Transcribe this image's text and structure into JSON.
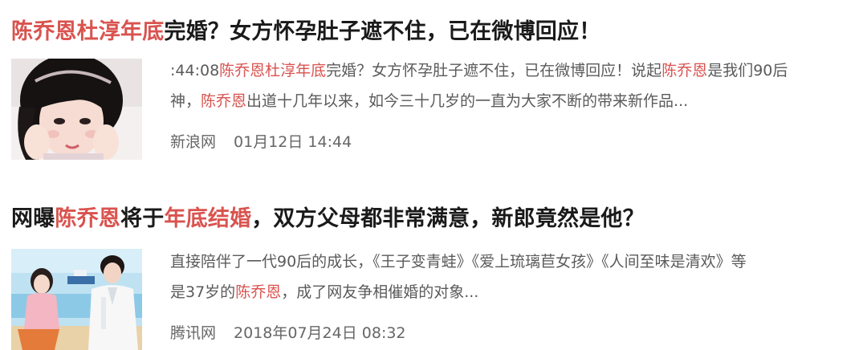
{
  "results": [
    {
      "title": {
        "segments": [
          {
            "text": "陈乔恩杜淳年底",
            "highlight": true
          },
          {
            "text": "完婚？女方怀孕肚子遮不住，已在微博回应！",
            "highlight": false
          }
        ]
      },
      "thumbnail": "portrait-photo-woman-hands-on-cheeks",
      "snippet": {
        "line1": [
          {
            "text": ":44:08",
            "highlight": false
          },
          {
            "text": "陈乔恩杜淳年底",
            "highlight": true
          },
          {
            "text": "完婚？女方怀孕肚子遮不住，已在微博回应！说起",
            "highlight": false
          },
          {
            "text": "陈乔恩",
            "highlight": true
          },
          {
            "text": "是我们90后",
            "highlight": false
          }
        ],
        "line2": [
          {
            "text": "神，",
            "highlight": false
          },
          {
            "text": "陈乔恩",
            "highlight": true
          },
          {
            "text": "出道十几年以来，如今三十几岁的一直为大家不断的带来新作品...",
            "highlight": false
          }
        ]
      },
      "source": "新浪网",
      "date": "01月12日 14:44"
    },
    {
      "title": {
        "segments": [
          {
            "text": "网曝",
            "highlight": false
          },
          {
            "text": "陈乔恩",
            "highlight": true
          },
          {
            "text": "将于",
            "highlight": false
          },
          {
            "text": "年底结婚",
            "highlight": true
          },
          {
            "text": "，双方父母都非常满意，新郎竟然是他？",
            "highlight": false
          }
        ]
      },
      "thumbnail": "drama-still-couple-poster",
      "snippet": {
        "line1": [
          {
            "text": "直接陪伴了一代90后的成长，《王子变青蛙》《爱上琉璃苣女孩》《人间至味是清欢》等",
            "highlight": false
          }
        ],
        "line2": [
          {
            "text": "是37岁的",
            "highlight": false
          },
          {
            "text": "陈乔恩",
            "highlight": true
          },
          {
            "text": "，成了网友争相催婚的对象...",
            "highlight": false
          }
        ]
      },
      "source": "腾讯网",
      "date": "2018年07月24日 08:32"
    }
  ],
  "colors": {
    "title": "#1a1a1a",
    "highlight": "#d9534f",
    "snippet": "#5a5a5a",
    "meta": "#666666"
  }
}
